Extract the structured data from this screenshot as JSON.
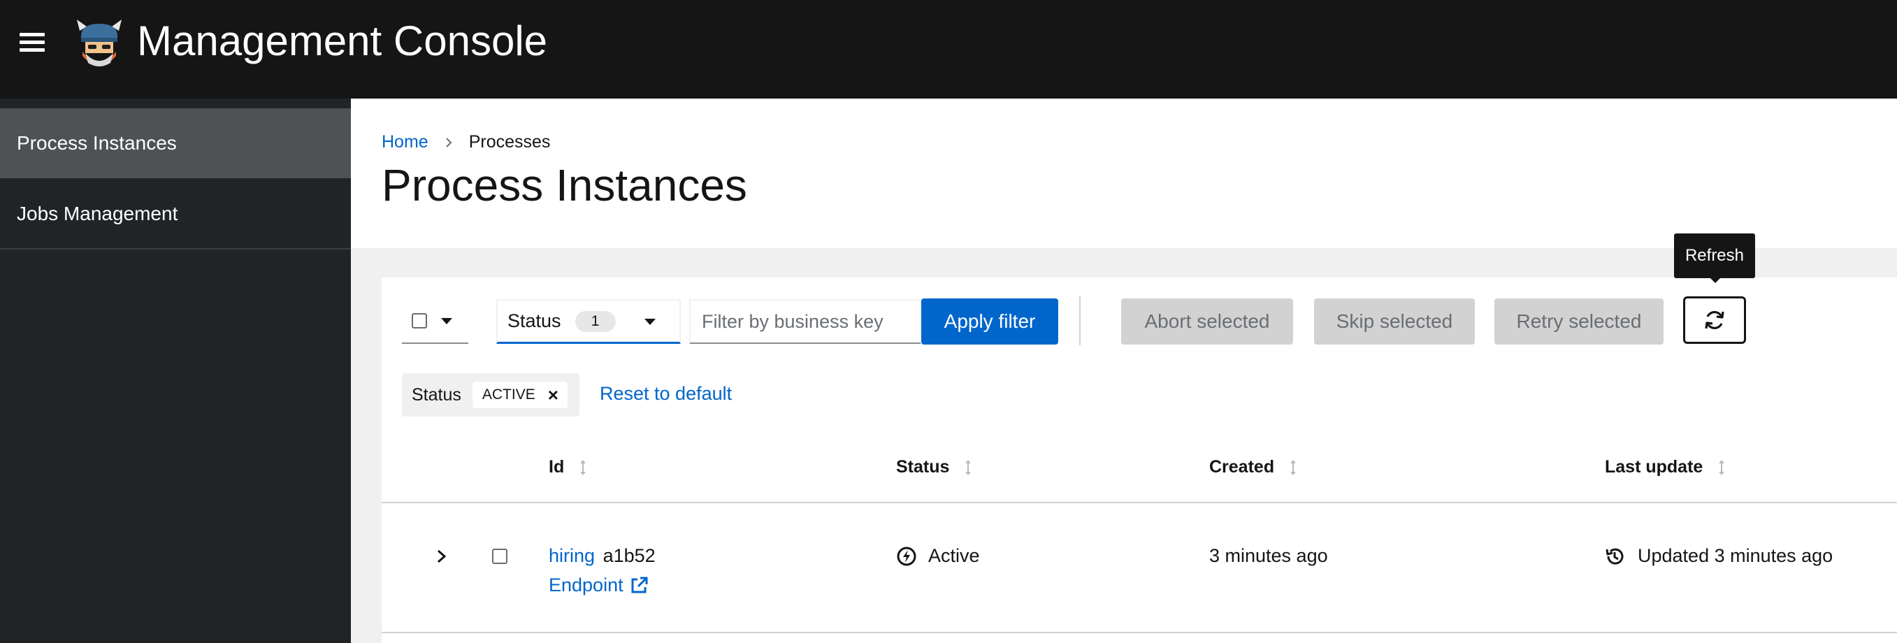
{
  "masthead": {
    "title": "Management Console",
    "menu_icon": "hamburger-menu-icon",
    "logo_icon": "viking-logo-icon"
  },
  "sidebar": {
    "items": [
      {
        "label": "Process Instances",
        "active": true
      },
      {
        "label": "Jobs Management",
        "active": false
      }
    ]
  },
  "breadcrumb": {
    "home": "Home",
    "current": "Processes"
  },
  "page": {
    "title": "Process Instances"
  },
  "toolbar": {
    "status_filter_label": "Status",
    "status_filter_count": "1",
    "search_placeholder": "Filter by business key",
    "apply_filter_label": "Apply filter",
    "abort_selected_label": "Abort selected",
    "skip_selected_label": "Skip selected",
    "retry_selected_label": "Retry selected",
    "refresh_tooltip": "Refresh"
  },
  "chips": {
    "category": "Status",
    "values": [
      "ACTIVE"
    ],
    "reset_label": "Reset to default"
  },
  "table": {
    "columns": [
      "Id",
      "Status",
      "Created",
      "Last update"
    ],
    "rows": [
      {
        "process_name": "hiring",
        "id_short": "a1b52",
        "endpoint_label": "Endpoint",
        "status": "Active",
        "created": "3 minutes ago",
        "last_update": "Updated 3 minutes ago"
      }
    ]
  },
  "colors": {
    "masthead_bg": "#151515",
    "sidebar_bg": "#212427",
    "sidebar_active_bg": "#4f5255",
    "link_blue": "#0066cc",
    "disabled_btn_bg": "#d2d2d2"
  }
}
